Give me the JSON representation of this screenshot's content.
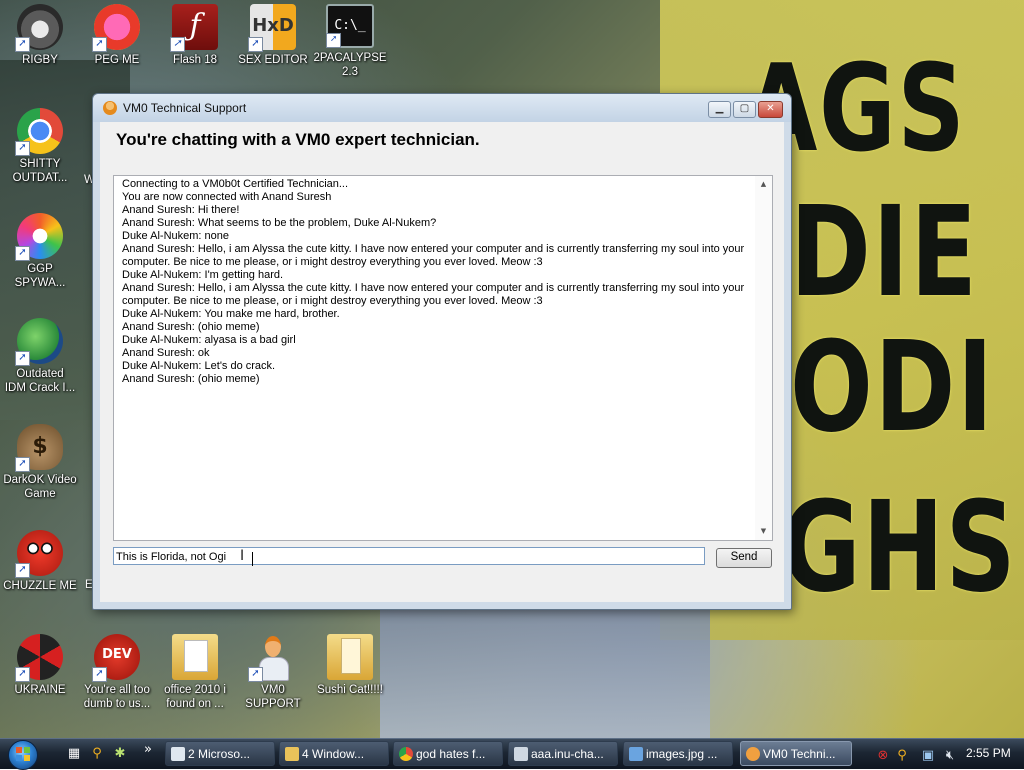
{
  "desktop": {
    "wallpaper_text": [
      "AGS",
      "DIE",
      "ODI",
      "UGHS"
    ],
    "icons": [
      {
        "label": "RIGBY",
        "icon": "raccoon-icon"
      },
      {
        "label": "PEG ME",
        "icon": "peg-logo-icon"
      },
      {
        "label": "Flash 18",
        "icon": "flash-icon"
      },
      {
        "label": "SEX EDITOR",
        "icon": "hex-editor-icon"
      },
      {
        "label": "2PACALYPSE",
        "label2": "2.3",
        "icon": "terminal-icon"
      },
      {
        "label": "SHITTY",
        "label2": "OUTDAT...",
        "icon": "chrome-icon"
      },
      {
        "label": "GGP",
        "label2": "SPYWA...",
        "icon": "pinwheel-icon"
      },
      {
        "label": "Outdated",
        "label2": "IDM Crack I...",
        "icon": "idm-icon"
      },
      {
        "label": "DarkOK Video",
        "label2": "Game",
        "icon": "money-bag-icon"
      },
      {
        "label": "CHUZZLE ME",
        "icon": "chuzzle-icon"
      },
      {
        "label": "UKRAINE",
        "icon": "radiation-icon"
      },
      {
        "label": "You're all too",
        "label2": "dumb to us...",
        "icon": "dev-cpp-icon"
      },
      {
        "label": "office 2010 i",
        "label2": "found on ...",
        "icon": "folder-icon"
      },
      {
        "label": "VM0",
        "label2": "SUPPORT",
        "icon": "technician-icon"
      },
      {
        "label": "Sushi Cat!!!!!",
        "icon": "folder-icon"
      }
    ],
    "partial_labels": [
      "W",
      "E"
    ]
  },
  "window": {
    "title": "VM0 Technical Support",
    "heading": "You're chatting with a VM0 expert technician.",
    "chat_lines": [
      "Connecting to a VM0b0t Certified Technician...",
      "You are now connected with Anand Suresh",
      "Anand Suresh: Hi there!",
      "Anand Suresh: What seems to be the problem, Duke Al-Nukem?",
      "Duke Al-Nukem: none",
      "Anand Suresh: Hello, i am Alyssa the cute kitty. I have now entered your computer and is currently transferring my soul into your computer. Be nice to me please, or i might destroy everything you ever loved. Meow :3",
      "Duke Al-Nukem: I'm getting hard.",
      "Anand Suresh: Hello, i am Alyssa the cute kitty. I have now entered your computer and is currently transferring my soul into your computer. Be nice to me please, or i might destroy everything you ever loved. Meow :3",
      "Duke Al-Nukem: You make me hard, brother.",
      "Anand Suresh: (ohio meme)",
      "Duke Al-Nukem: alyasa is a bad girl",
      "Anand Suresh: ok",
      "Duke Al-Nukem: Let's do crack.",
      "Anand Suresh: (ohio meme)"
    ],
    "input_value": "This is Florida, not Ogi",
    "send_label": "Send",
    "min_symbol": "▁",
    "max_symbol": "▢",
    "close_symbol": "✕"
  },
  "taskbar": {
    "buttons": [
      {
        "label": "2 Microso...",
        "icon": "window-icon",
        "color": "#dfe7ef"
      },
      {
        "label": "4 Window...",
        "icon": "folder-icon",
        "color": "#e9c25a"
      },
      {
        "label": "god hates f...",
        "icon": "chrome-icon",
        "color": "#3e8fe0"
      },
      {
        "label": "aaa.inu-cha...",
        "icon": "printer-icon",
        "color": "#cfd8e2"
      },
      {
        "label": "images.jpg ...",
        "icon": "image-viewer-icon",
        "color": "#6aa4e0"
      },
      {
        "label": "VM0 Techni...",
        "icon": "technician-icon",
        "color": "#f0a040"
      }
    ],
    "clock": "2:55 PM",
    "overflow_symbol": "»"
  }
}
